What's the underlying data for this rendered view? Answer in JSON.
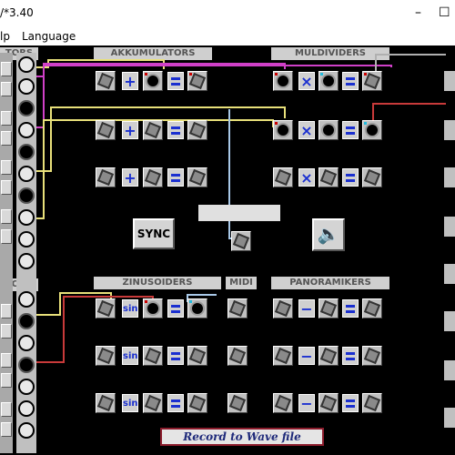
{
  "window": {
    "title": "/*3.40",
    "minimize": "–",
    "maximize": "☐"
  },
  "menu": {
    "items": [
      "lp",
      "Language"
    ]
  },
  "sections": {
    "left": "TORS",
    "akkumulators": "AKKUMULATORS",
    "muldividers": "MULDIVIDERS",
    "zinusoiders": "ZINUSOIDERS",
    "midi": "MIDI",
    "panoramikers": "PANORAMIKERS"
  },
  "ops": {
    "plus": "+",
    "times": "×",
    "sin": "sin",
    "minus": "−"
  },
  "buttons": {
    "sync": "SYNC",
    "record": "Record to Wave file"
  },
  "icons": {
    "speaker": "speaker-icon"
  },
  "colors": {
    "background": "#000000",
    "panel": "#c0c0c0",
    "operator": "#1a2fd0",
    "wire_yellow": "#e8e07a",
    "wire_magenta": "#d040c8",
    "wire_red": "#c83a3a",
    "wire_lightblue": "#a8c8e8"
  }
}
